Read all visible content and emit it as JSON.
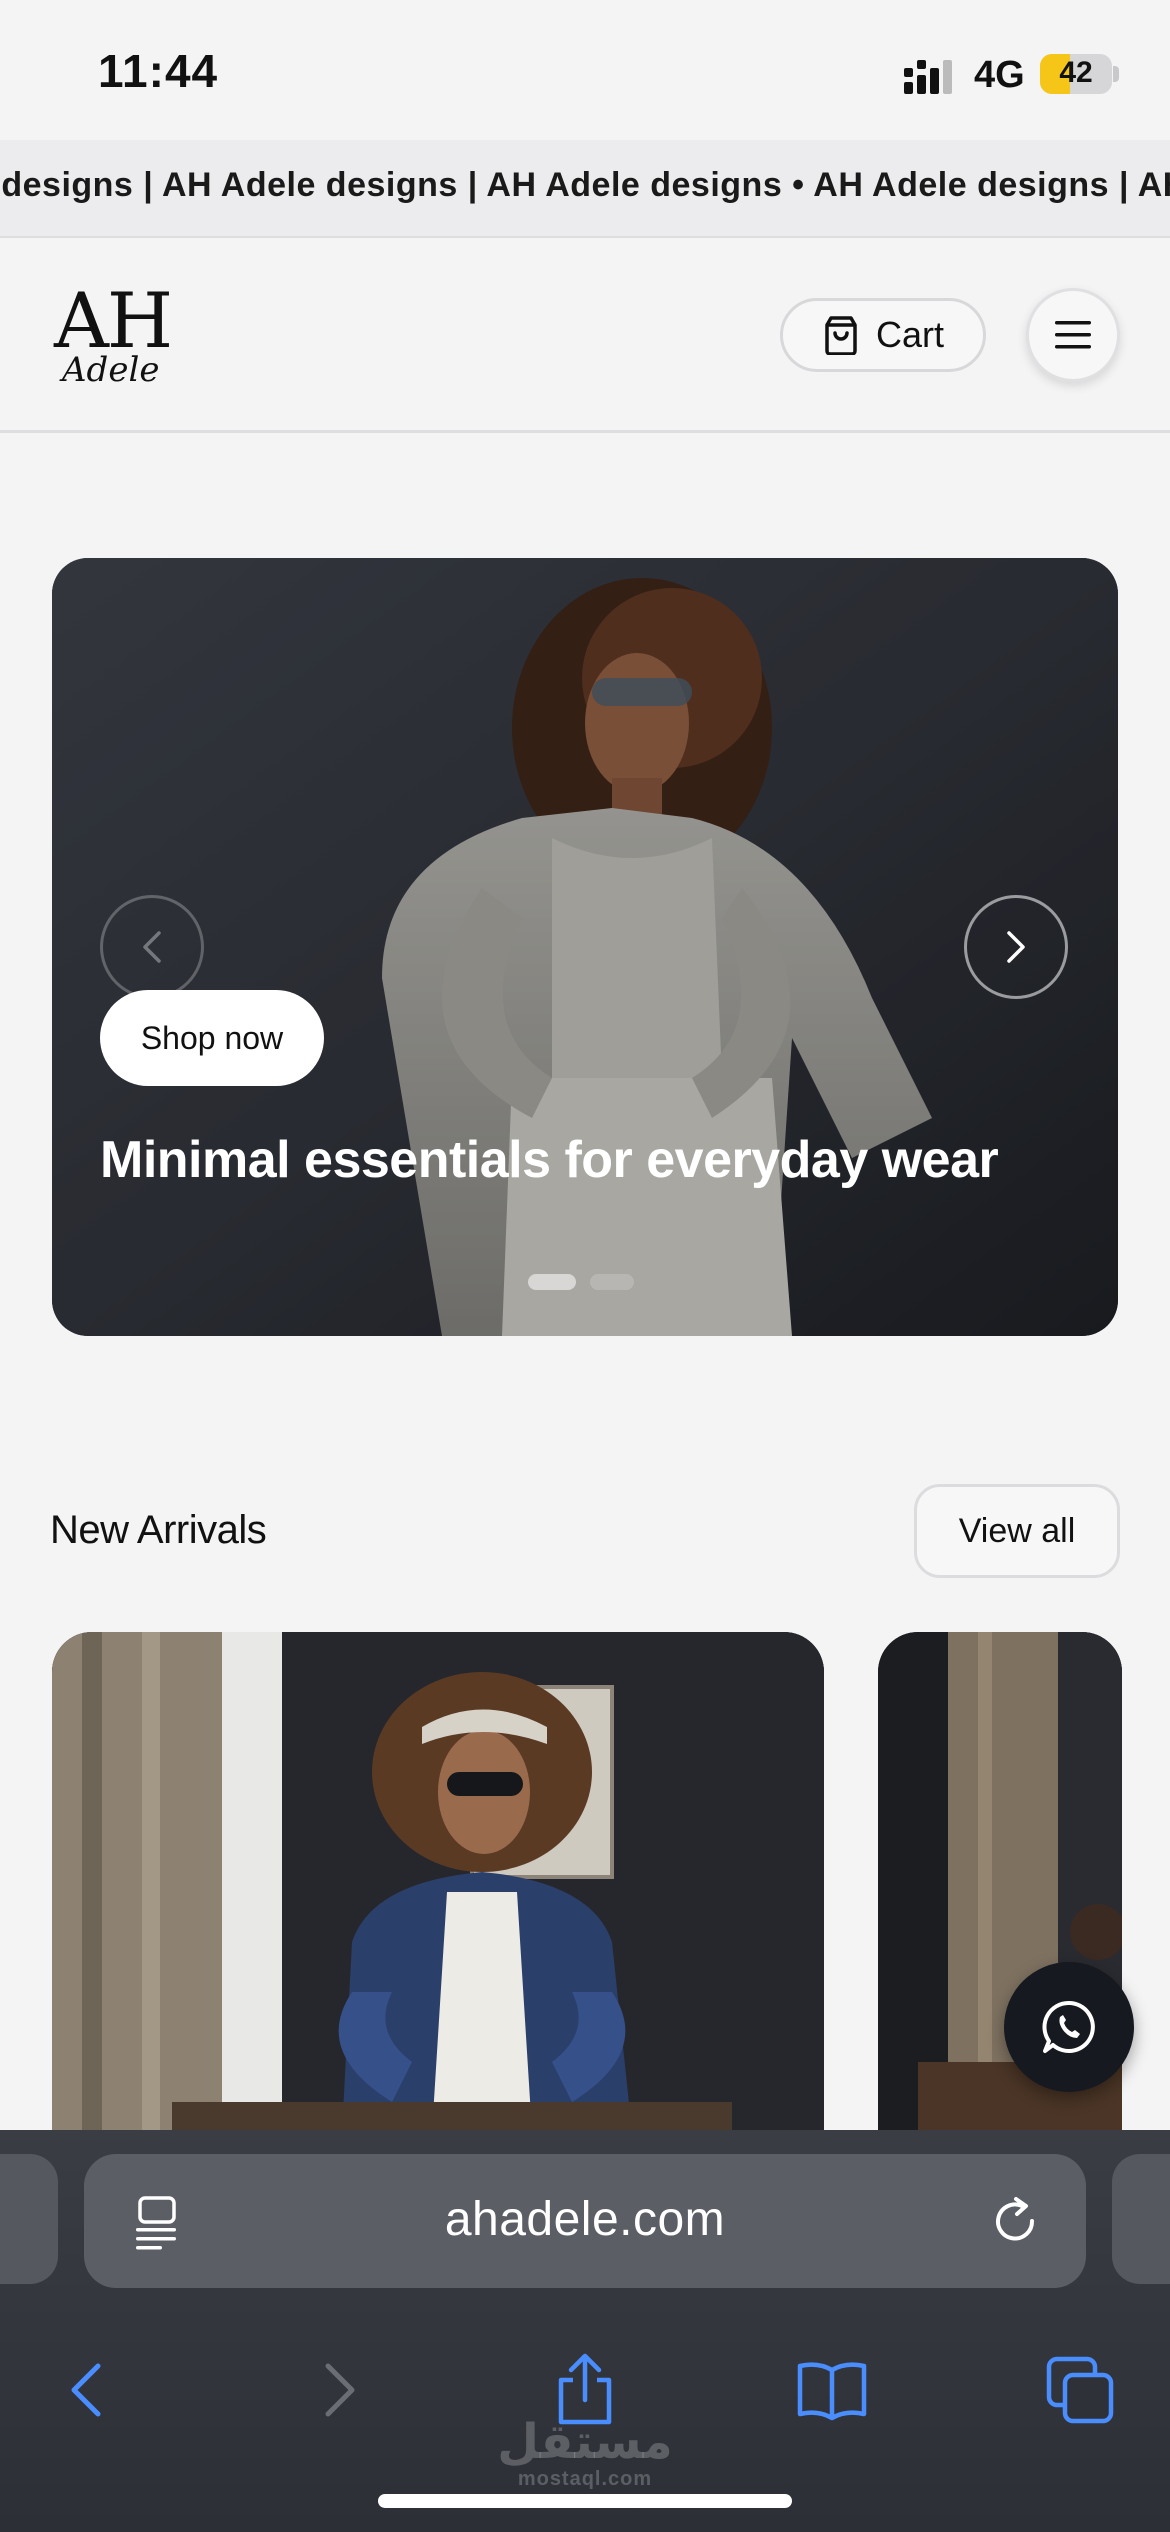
{
  "status_bar": {
    "time": "11:44",
    "network": "4G",
    "battery": "42",
    "battery_level": 0.42
  },
  "marquee": {
    "text": "e designs | AH Adele designs | AH Adele designs • AH Adele designs | AH Adele designs"
  },
  "header": {
    "logo_mark": "AH",
    "logo_sub": "Adele",
    "cart_label": "Cart"
  },
  "hero": {
    "cta_label": "Shop now",
    "headline": "Minimal essentials for everyday wear",
    "slide_count": 2,
    "active_slide": 1
  },
  "new_arrivals": {
    "title": "New Arrivals",
    "view_all_label": "View all"
  },
  "browser": {
    "url": "ahadele.com"
  },
  "watermark": {
    "arabic": "مستقل",
    "latin": "mostaql.com"
  },
  "icons": {
    "cart": "shopping-bag-icon",
    "menu": "hamburger-icon",
    "prev": "chevron-left-icon",
    "next": "chevron-right-icon",
    "whatsapp": "whatsapp-icon",
    "reader": "reader-mode-icon",
    "reload": "reload-icon",
    "back": "back-arrow-icon",
    "forward": "forward-arrow-icon",
    "share": "share-icon",
    "bookmarks": "bookmarks-icon",
    "tabs": "tabs-icon"
  },
  "colors": {
    "accent_blue": "#4a8dff",
    "battery_yellow": "#f5c518"
  }
}
